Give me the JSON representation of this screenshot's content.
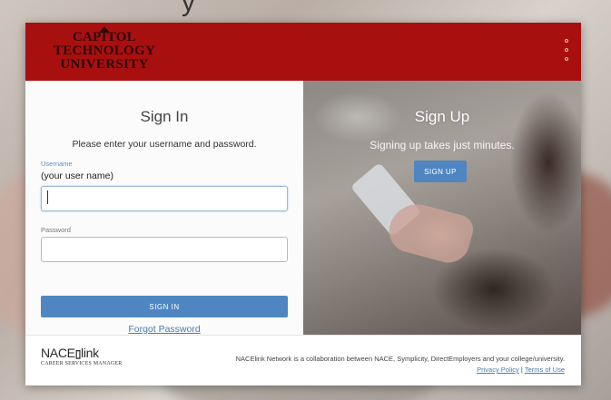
{
  "background": {
    "partial_heading": "y"
  },
  "header": {
    "logo_lines": [
      "CAPITOL",
      "TECHNOLOGY",
      "UNIVERSITY"
    ],
    "brand_color": "#a8100f",
    "menu_icon": "vertical-dots-icon"
  },
  "signin": {
    "title": "Sign In",
    "instructions": "Please enter your username and password.",
    "username_label": "Username",
    "username_hint": "(your user name)",
    "username_value": "",
    "password_label": "Password",
    "password_value": "",
    "submit_label": "SIGN IN",
    "forgot_label": "Forgot Password"
  },
  "signup": {
    "title": "Sign Up",
    "subtitle": "Signing up takes just minutes.",
    "button_label": "SIGN UP"
  },
  "footer": {
    "logo_brand_prefix": "NACE",
    "logo_brand_suffix": "link",
    "logo_tagline": "CAREER SERVICES MANAGER",
    "description": "NACElink Network is a collaboration between NACE, Symplicity, DirectEmployers and your college/university.",
    "privacy_label": "Privacy Policy",
    "separator": "|",
    "terms_label": "Terms of Use"
  },
  "colors": {
    "accent_button": "#4f86c1",
    "link": "#4a7bb0"
  }
}
